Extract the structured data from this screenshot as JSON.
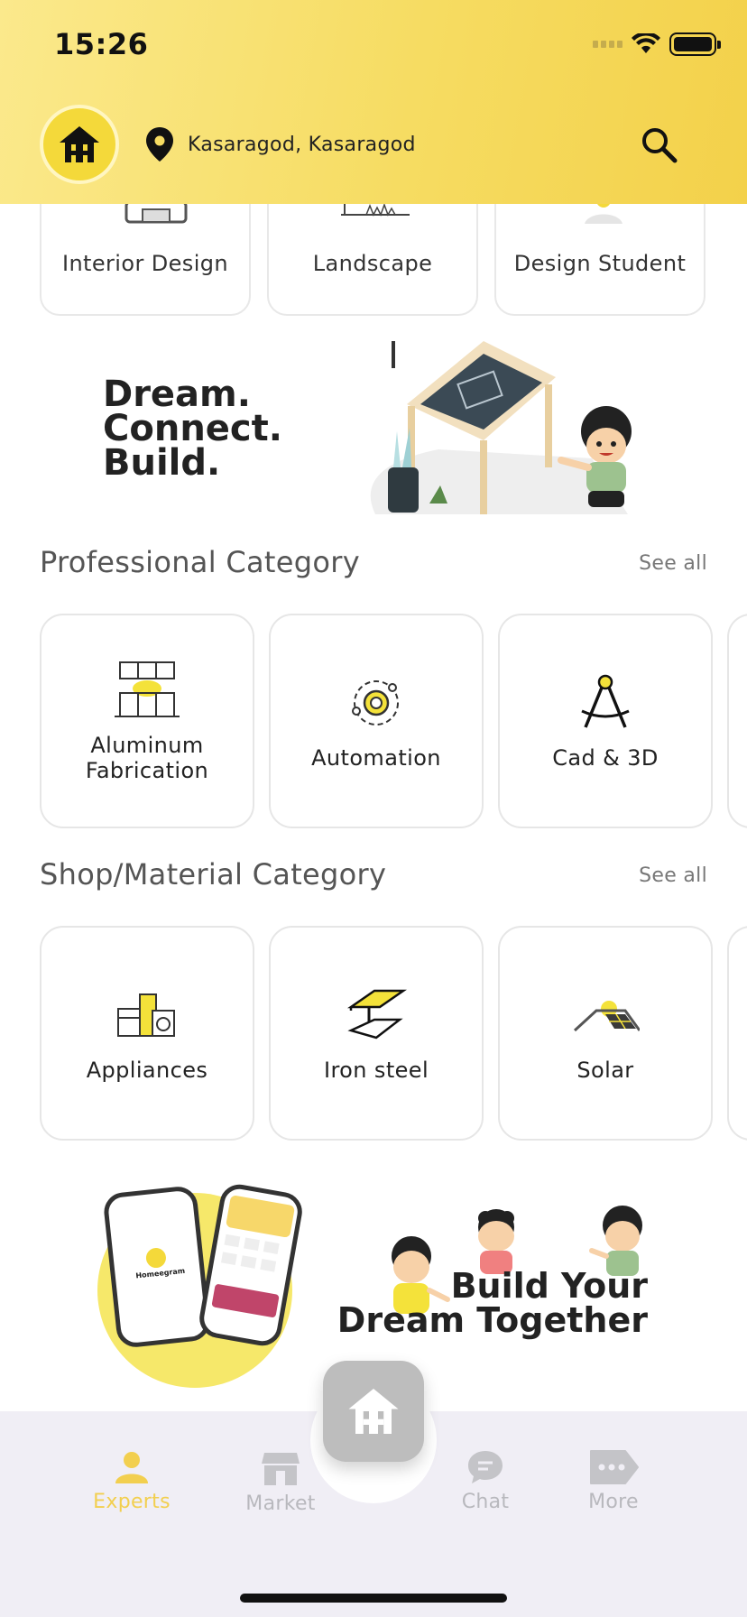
{
  "status_bar": {
    "time": "15:26"
  },
  "header": {
    "location": "Kasaragod, Kasaragod"
  },
  "top_categories": [
    {
      "label": "Interior Design",
      "icon": "sofa-icon"
    },
    {
      "label": "Landscape",
      "icon": "garden-icon"
    },
    {
      "label": "Design Student",
      "icon": "lightbulb-icon"
    }
  ],
  "banner": {
    "line1": "Dream.",
    "line2": "Connect.",
    "line3": "Build."
  },
  "professional": {
    "title": "Professional Category",
    "see_all": "See all",
    "items": [
      {
        "label1": "Aluminum",
        "label2": "Fabrication",
        "icon": "cabinet-icon"
      },
      {
        "label1": "Automation",
        "label2": "",
        "icon": "gear-automation-icon"
      },
      {
        "label1": "Cad & 3D",
        "label2": "",
        "icon": "compass-icon"
      }
    ]
  },
  "shop": {
    "title": "Shop/Material Category",
    "see_all": "See all",
    "items": [
      {
        "label": "Appliances",
        "icon": "appliances-icon"
      },
      {
        "label": "Iron steel",
        "icon": "steel-beam-icon"
      },
      {
        "label": "Solar",
        "icon": "solar-panel-icon"
      }
    ]
  },
  "promo": {
    "line1": "Build Your",
    "line2": "Dream Together",
    "app_name": "Homeegram"
  },
  "nav": {
    "items": [
      {
        "label": "Experts",
        "icon": "person-icon",
        "active": true
      },
      {
        "label": "Market",
        "icon": "store-icon",
        "active": false
      },
      {
        "label": "Chat",
        "icon": "chat-icon",
        "active": false
      },
      {
        "label": "More",
        "icon": "more-tag-icon",
        "active": false
      }
    ]
  },
  "colors": {
    "accent": "#f3d14a",
    "nav_active": "#f2cf4f",
    "nav_inactive": "#b8b8bd"
  }
}
